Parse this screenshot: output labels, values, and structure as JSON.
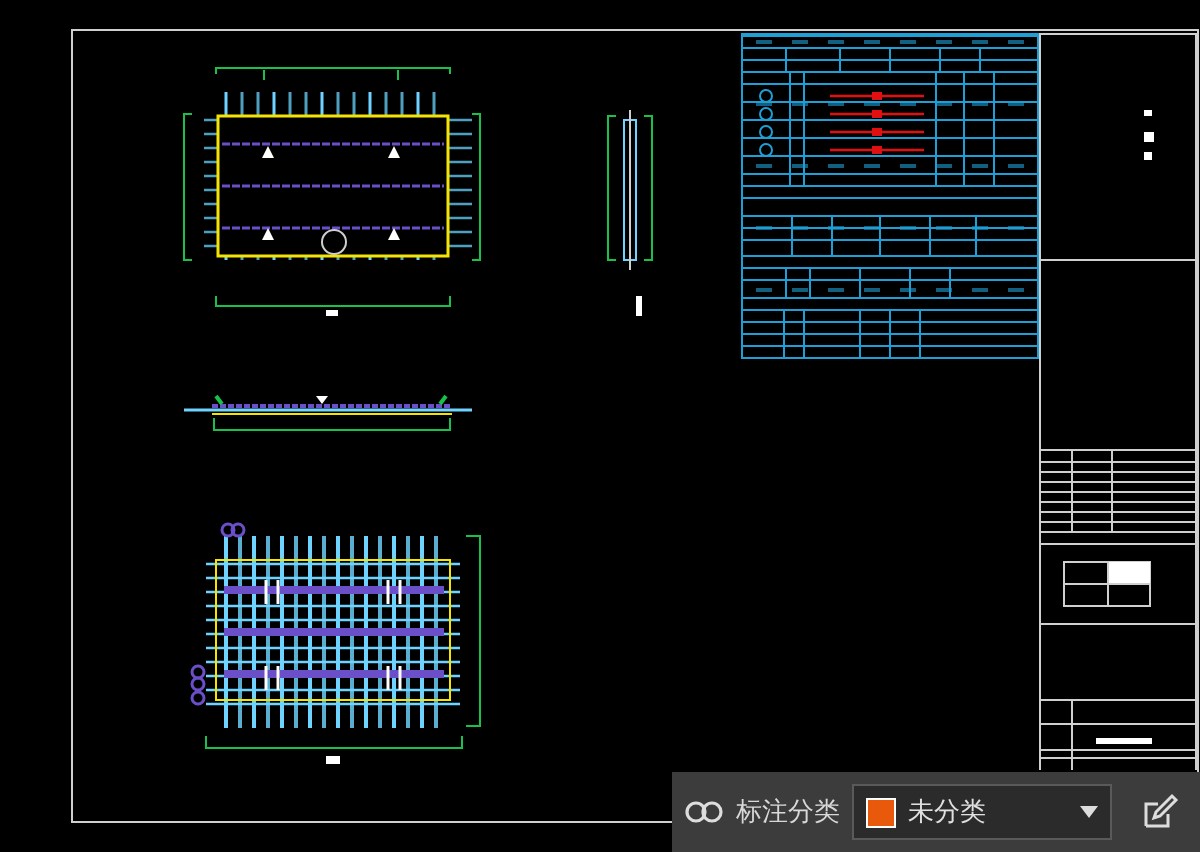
{
  "toolbar": {
    "label": "标注分类",
    "dropdown": {
      "value": "未分类"
    }
  }
}
